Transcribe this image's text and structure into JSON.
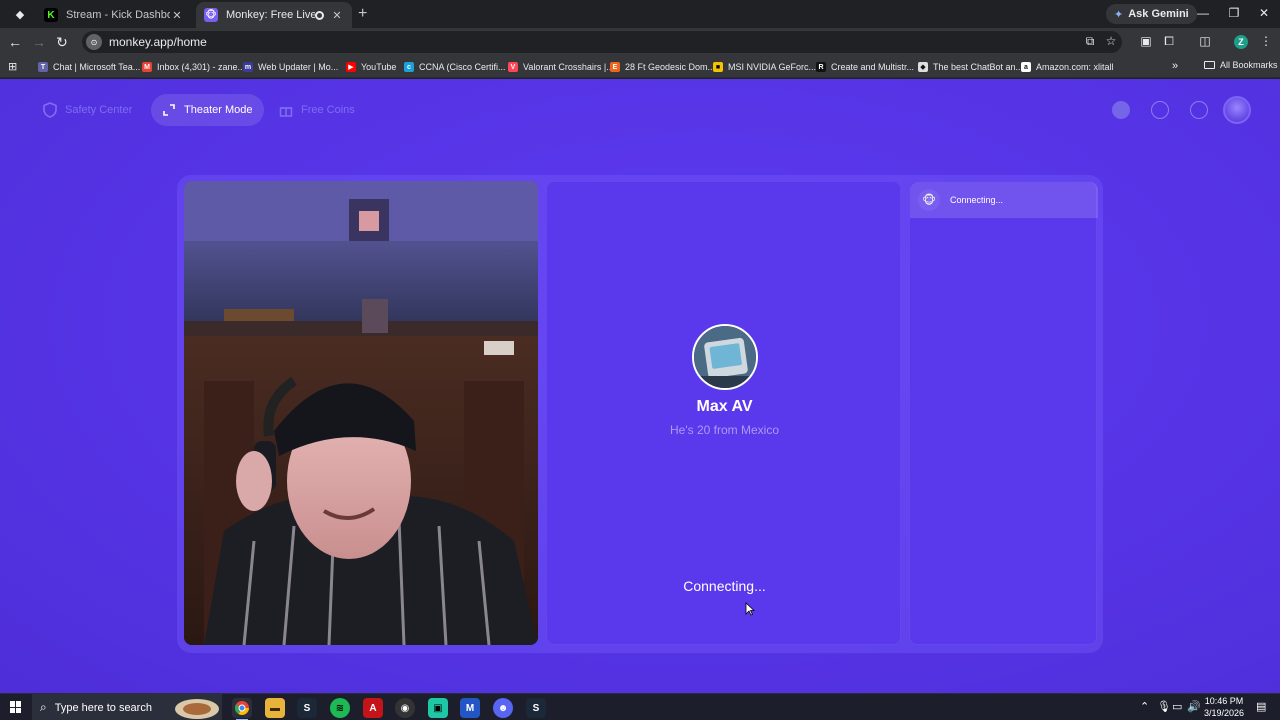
{
  "browser": {
    "tabs": [
      {
        "title": "Stream - Kick Dashboard",
        "favicon": "kick-icon",
        "active": false
      },
      {
        "title": "Monkey: Free Live Video Ch",
        "favicon": "monkey-icon",
        "active": true
      }
    ],
    "gemini_label": "Ask Gemini",
    "url": "monkey.app/home",
    "profile_initial": "Z",
    "bookmarks": [
      {
        "label": "Chat | Microsoft Tea...",
        "icon": "teams-icon",
        "color": "#6264a7"
      },
      {
        "label": "Inbox (4,301) - zane...",
        "icon": "gmail-icon",
        "color": "#ea4335"
      },
      {
        "label": "Web Updater | Mo...",
        "icon": "m-icon",
        "color": "#3b3b98"
      },
      {
        "label": "YouTube",
        "icon": "youtube-icon",
        "color": "#ff0000"
      },
      {
        "label": "CCNA (Cisco Certifi...",
        "icon": "cisco-icon",
        "color": "#1ba0d7"
      },
      {
        "label": "Valorant Crosshairs |...",
        "icon": "valorant-icon",
        "color": "#ff4655"
      },
      {
        "label": "28 Ft Geodesic Dom...",
        "icon": "e-icon",
        "color": "#f1641e"
      },
      {
        "label": "MSI NVIDIA GeForc...",
        "icon": "msi-icon",
        "color": "#f5c400"
      },
      {
        "label": "Create and Multistr...",
        "icon": "r-icon",
        "color": "#111111"
      },
      {
        "label": "The best ChatBot an...",
        "icon": "chatbot-icon",
        "color": "#dddddd"
      },
      {
        "label": "Amazon.com: xlitall",
        "icon": "amazon-icon",
        "color": "#ffffff"
      }
    ],
    "all_bookmarks": "All Bookmarks"
  },
  "page": {
    "nav": {
      "safety": "Safety Center",
      "theater": "Theater Mode",
      "coins": "Free Coins"
    },
    "remote": {
      "name": "Max AV",
      "subtitle": "He's 20 from Mexico",
      "status": "Connecting..."
    },
    "chat": {
      "status": "Connecting..."
    },
    "accent": "#5634e6"
  },
  "taskbar": {
    "search_placeholder": "Type here to search",
    "time": "10:46 PM",
    "date": "3/19/2026"
  }
}
